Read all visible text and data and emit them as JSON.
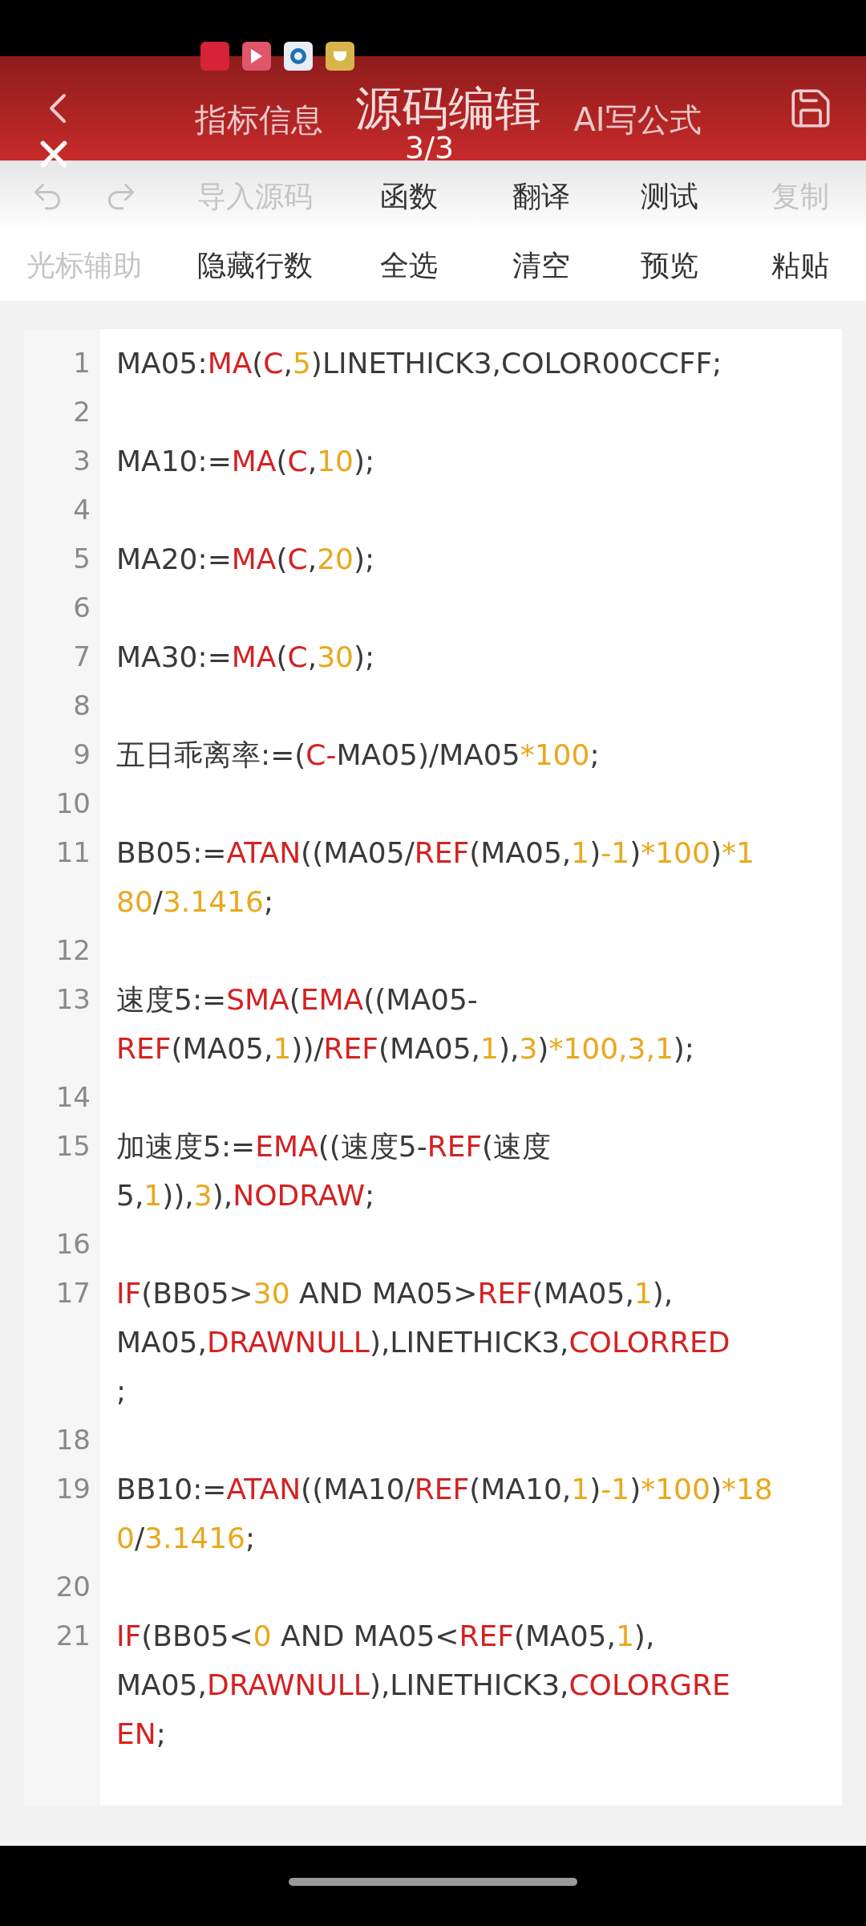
{
  "viewer": {
    "counter": "3/3"
  },
  "header": {
    "tabs": [
      {
        "label": "指标信息",
        "selected": false
      },
      {
        "label": "源码编辑",
        "selected": true
      },
      {
        "label": "AI写公式",
        "selected": false
      }
    ]
  },
  "toolbar": {
    "rows": [
      {
        "items": [
          {
            "kind": "undo",
            "disabled": true
          },
          {
            "kind": "redo",
            "disabled": true
          },
          {
            "kind": "text",
            "label": "导入源码",
            "disabled": true
          },
          {
            "kind": "text",
            "label": "函数",
            "disabled": false
          },
          {
            "kind": "text",
            "label": "翻译",
            "disabled": false
          },
          {
            "kind": "text",
            "label": "测试",
            "disabled": false
          },
          {
            "kind": "text",
            "label": "复制",
            "disabled": true
          }
        ]
      },
      {
        "items": [
          {
            "kind": "text",
            "label": "光标辅助",
            "disabled": true
          },
          {
            "kind": "text",
            "label": "隐藏行数",
            "disabled": false
          },
          {
            "kind": "text",
            "label": "全选",
            "disabled": false
          },
          {
            "kind": "text",
            "label": "清空",
            "disabled": false
          },
          {
            "kind": "text",
            "label": "预览",
            "disabled": false
          },
          {
            "kind": "text",
            "label": "粘贴",
            "disabled": false
          }
        ]
      }
    ]
  },
  "editor": {
    "lines": [
      {
        "number": "1",
        "rows": [
          {
            "tokens": [
              {
                "kind": "plain",
                "text": "MA05:"
              },
              {
                "kind": "keyword",
                "text": "MA"
              },
              {
                "kind": "plain",
                "text": "("
              },
              {
                "kind": "keyword",
                "text": "C"
              },
              {
                "kind": "plain",
                "text": ","
              },
              {
                "kind": "number",
                "text": "5"
              },
              {
                "kind": "plain",
                "text": ")LINETHICK3,COLOR00CCFF;"
              }
            ]
          }
        ]
      },
      {
        "number": "2",
        "rows": [
          {}
        ]
      },
      {
        "number": "3",
        "rows": [
          {
            "tokens": [
              {
                "kind": "plain",
                "text": "MA10:="
              },
              {
                "kind": "keyword",
                "text": "MA"
              },
              {
                "kind": "plain",
                "text": "("
              },
              {
                "kind": "keyword",
                "text": "C"
              },
              {
                "kind": "plain",
                "text": ","
              },
              {
                "kind": "number",
                "text": "10"
              },
              {
                "kind": "plain",
                "text": ");"
              }
            ]
          }
        ]
      },
      {
        "number": "4",
        "rows": [
          {}
        ]
      },
      {
        "number": "5",
        "rows": [
          {
            "tokens": [
              {
                "kind": "plain",
                "text": "MA20:="
              },
              {
                "kind": "keyword",
                "text": "MA"
              },
              {
                "kind": "plain",
                "text": "("
              },
              {
                "kind": "keyword",
                "text": "C"
              },
              {
                "kind": "plain",
                "text": ","
              },
              {
                "kind": "number",
                "text": "20"
              },
              {
                "kind": "plain",
                "text": ");"
              }
            ]
          }
        ]
      },
      {
        "number": "6",
        "rows": [
          {}
        ]
      },
      {
        "number": "7",
        "rows": [
          {
            "tokens": [
              {
                "kind": "plain",
                "text": "MA30:="
              },
              {
                "kind": "keyword",
                "text": "MA"
              },
              {
                "kind": "plain",
                "text": "("
              },
              {
                "kind": "keyword",
                "text": "C"
              },
              {
                "kind": "plain",
                "text": ","
              },
              {
                "kind": "number",
                "text": "30"
              },
              {
                "kind": "plain",
                "text": ");"
              }
            ]
          }
        ]
      },
      {
        "number": "8",
        "rows": [
          {}
        ]
      },
      {
        "number": "9",
        "rows": [
          {
            "tokens": [
              {
                "kind": "plain",
                "text": "五日乖离率:=("
              },
              {
                "kind": "keyword",
                "text": "C-"
              },
              {
                "kind": "plain",
                "text": "MA05)/MA05"
              },
              {
                "kind": "number",
                "text": "*100"
              },
              {
                "kind": "plain",
                "text": ";"
              }
            ]
          }
        ]
      },
      {
        "number": "10",
        "rows": [
          {}
        ]
      },
      {
        "number": "11",
        "rows": [
          {
            "tokens": [
              {
                "kind": "plain",
                "text": "BB05:="
              },
              {
                "kind": "keyword",
                "text": "ATAN"
              },
              {
                "kind": "plain",
                "text": "((MA05/"
              },
              {
                "kind": "keyword",
                "text": "REF"
              },
              {
                "kind": "plain",
                "text": "(MA05,"
              },
              {
                "kind": "number",
                "text": "1"
              },
              {
                "kind": "plain",
                "text": ")"
              },
              {
                "kind": "number",
                "text": "-1"
              },
              {
                "kind": "plain",
                "text": ")"
              },
              {
                "kind": "number",
                "text": "*100"
              },
              {
                "kind": "plain",
                "text": ")"
              },
              {
                "kind": "number",
                "text": "*1"
              }
            ]
          },
          {
            "tokens": [
              {
                "kind": "number",
                "text": "80"
              },
              {
                "kind": "plain",
                "text": "/"
              },
              {
                "kind": "number",
                "text": "3.1416"
              },
              {
                "kind": "plain",
                "text": ";"
              }
            ]
          }
        ]
      },
      {
        "number": "12",
        "rows": [
          {}
        ]
      },
      {
        "number": "13",
        "rows": [
          {
            "tokens": [
              {
                "kind": "plain",
                "text": "速度5:="
              },
              {
                "kind": "keyword",
                "text": "SMA"
              },
              {
                "kind": "plain",
                "text": "("
              },
              {
                "kind": "keyword",
                "text": "EMA"
              },
              {
                "kind": "plain",
                "text": "((MA05-"
              }
            ]
          },
          {
            "tokens": [
              {
                "kind": "keyword",
                "text": "REF"
              },
              {
                "kind": "plain",
                "text": "(MA05,"
              },
              {
                "kind": "number",
                "text": "1"
              },
              {
                "kind": "plain",
                "text": "))/"
              },
              {
                "kind": "keyword",
                "text": "REF"
              },
              {
                "kind": "plain",
                "text": "(MA05,"
              },
              {
                "kind": "number",
                "text": "1"
              },
              {
                "kind": "plain",
                "text": "),"
              },
              {
                "kind": "number",
                "text": "3"
              },
              {
                "kind": "plain",
                "text": ")"
              },
              {
                "kind": "number",
                "text": "*100,3,1"
              },
              {
                "kind": "plain",
                "text": ");"
              }
            ]
          }
        ]
      },
      {
        "number": "14",
        "rows": [
          {}
        ]
      },
      {
        "number": "15",
        "rows": [
          {
            "tokens": [
              {
                "kind": "plain",
                "text": "加速度5:="
              },
              {
                "kind": "keyword",
                "text": "EMA"
              },
              {
                "kind": "plain",
                "text": "((速度5-"
              },
              {
                "kind": "keyword",
                "text": "REF"
              },
              {
                "kind": "plain",
                "text": "(速度"
              }
            ]
          },
          {
            "tokens": [
              {
                "kind": "plain",
                "text": "5,"
              },
              {
                "kind": "number",
                "text": "1"
              },
              {
                "kind": "plain",
                "text": ")),"
              },
              {
                "kind": "number",
                "text": "3"
              },
              {
                "kind": "plain",
                "text": "),"
              },
              {
                "kind": "keyword",
                "text": "NODRAW"
              },
              {
                "kind": "plain",
                "text": ";"
              }
            ]
          }
        ]
      },
      {
        "number": "16",
        "rows": [
          {}
        ]
      },
      {
        "number": "17",
        "rows": [
          {
            "tokens": [
              {
                "kind": "keyword",
                "text": "IF"
              },
              {
                "kind": "plain",
                "text": "(BB05>"
              },
              {
                "kind": "number",
                "text": "30"
              },
              {
                "kind": "plain",
                "text": " AND MA05>"
              },
              {
                "kind": "keyword",
                "text": "REF"
              },
              {
                "kind": "plain",
                "text": "(MA05,"
              },
              {
                "kind": "number",
                "text": "1"
              },
              {
                "kind": "plain",
                "text": "),"
              }
            ]
          },
          {
            "tokens": [
              {
                "kind": "plain",
                "text": "MA05,"
              },
              {
                "kind": "keyword",
                "text": "DRAWNULL"
              },
              {
                "kind": "plain",
                "text": "),LINETHICK3,"
              },
              {
                "kind": "keyword",
                "text": "COLORRED"
              }
            ]
          },
          {
            "tokens": [
              {
                "kind": "plain",
                "text": ";"
              }
            ]
          }
        ]
      },
      {
        "number": "18",
        "rows": [
          {}
        ]
      },
      {
        "number": "19",
        "rows": [
          {
            "tokens": [
              {
                "kind": "plain",
                "text": "BB10:="
              },
              {
                "kind": "keyword",
                "text": "ATAN"
              },
              {
                "kind": "plain",
                "text": "((MA10/"
              },
              {
                "kind": "keyword",
                "text": "REF"
              },
              {
                "kind": "plain",
                "text": "(MA10,"
              },
              {
                "kind": "number",
                "text": "1"
              },
              {
                "kind": "plain",
                "text": ")"
              },
              {
                "kind": "number",
                "text": "-1"
              },
              {
                "kind": "plain",
                "text": ")"
              },
              {
                "kind": "number",
                "text": "*100"
              },
              {
                "kind": "plain",
                "text": ")"
              },
              {
                "kind": "number",
                "text": "*18"
              }
            ]
          },
          {
            "tokens": [
              {
                "kind": "number",
                "text": "0"
              },
              {
                "kind": "plain",
                "text": "/"
              },
              {
                "kind": "number",
                "text": "3.1416"
              },
              {
                "kind": "plain",
                "text": ";"
              }
            ]
          }
        ]
      },
      {
        "number": "20",
        "rows": [
          {}
        ]
      },
      {
        "number": "21",
        "rows": [
          {
            "tokens": [
              {
                "kind": "keyword",
                "text": "IF"
              },
              {
                "kind": "plain",
                "text": "(BB05<"
              },
              {
                "kind": "number",
                "text": "0"
              },
              {
                "kind": "plain",
                "text": " AND MA05<"
              },
              {
                "kind": "keyword",
                "text": "REF"
              },
              {
                "kind": "plain",
                "text": "(MA05,"
              },
              {
                "kind": "number",
                "text": "1"
              },
              {
                "kind": "plain",
                "text": "),"
              }
            ]
          },
          {
            "tokens": [
              {
                "kind": "plain",
                "text": "MA05,"
              },
              {
                "kind": "keyword",
                "text": "DRAWNULL"
              },
              {
                "kind": "plain",
                "text": "),LINETHICK3,"
              },
              {
                "kind": "keyword",
                "text": "COLORGRE"
              }
            ]
          },
          {
            "tokens": [
              {
                "kind": "keyword",
                "text": "EN"
              },
              {
                "kind": "plain",
                "text": ";"
              }
            ]
          }
        ]
      }
    ]
  }
}
